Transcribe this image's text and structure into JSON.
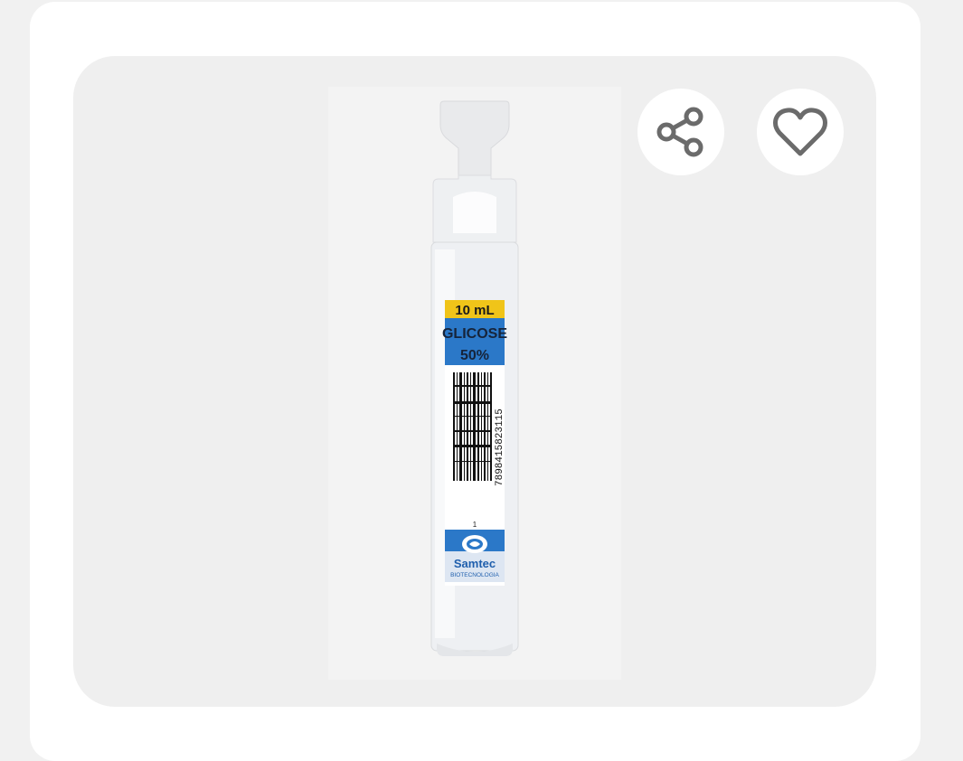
{
  "product": {
    "image_alt": "Glicose 50% 10 mL ampoule — Samtec Biotecnologia",
    "label": {
      "volume": "10 mL",
      "name": "GLICOSE",
      "concentration": "50%",
      "barcode_digits": "7898415823115",
      "lot_marker": "1",
      "brand": "Samtec",
      "brand_sub": "BIOTECNOLOGIA"
    }
  },
  "actions": {
    "share": {
      "icon": "share-icon"
    },
    "favorite": {
      "icon": "heart-icon"
    }
  },
  "colors": {
    "page_bg": "#f1f1f1",
    "card_bg": "#ffffff",
    "frame_bg": "#efefef",
    "icon": "#6b6b6b",
    "label_yellow": "#f0c419",
    "label_blue": "#2b78c8"
  }
}
